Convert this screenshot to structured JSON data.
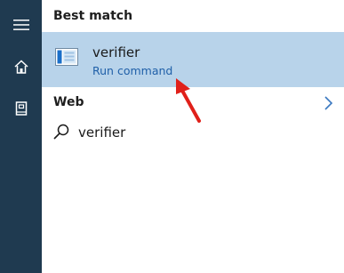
{
  "sidebar": {
    "icons": [
      "hamburger-icon",
      "home-icon",
      "notebook-icon"
    ],
    "background": "#1f3a50"
  },
  "results": {
    "best_match": {
      "section_label": "Best match",
      "title": "verifier",
      "subtitle": "Run command",
      "icon": "run-command-icon",
      "highlight_color": "#b8d3ea"
    },
    "web": {
      "section_label": "Web",
      "icon": "chevron-right-icon",
      "suggestion": "verifier",
      "suggestion_icon": "search-icon"
    }
  },
  "annotation": {
    "icon": "red-arrow",
    "color": "#e0201a"
  }
}
